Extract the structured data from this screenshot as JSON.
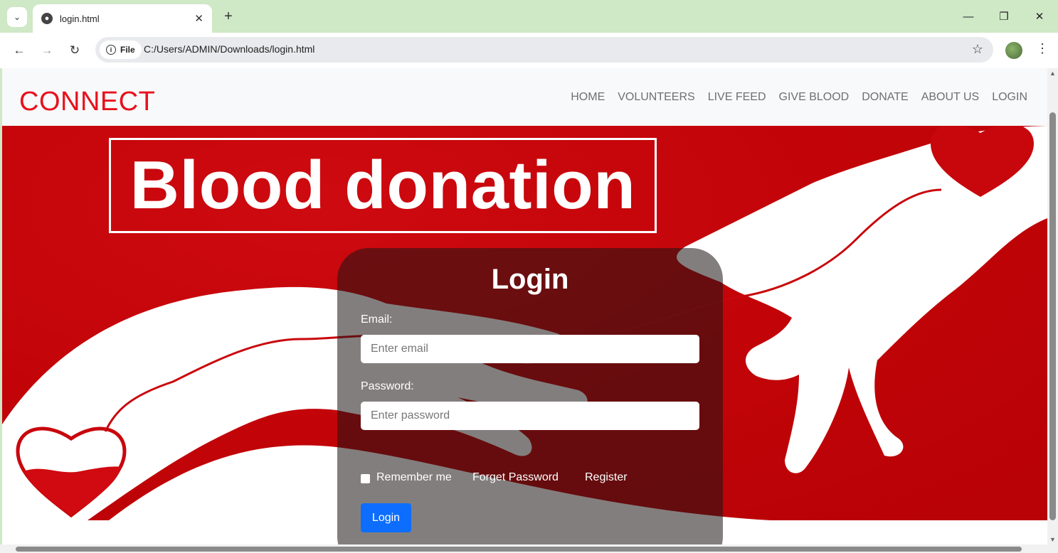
{
  "browser": {
    "tab_title": "login.html",
    "site_chip": "File",
    "url": "C:/Users/ADMIN/Downloads/login.html"
  },
  "site": {
    "brand": "CONNECT",
    "nav": [
      "HOME",
      "VOLUNTEERS",
      "LIVE FEED",
      "GIVE BLOOD",
      "DONATE",
      "ABOUT US",
      "LOGIN"
    ],
    "hero_title": "Blood donation"
  },
  "login": {
    "title": "Login",
    "email_label": "Email:",
    "email_placeholder": "Enter email",
    "password_label": "Password:",
    "password_placeholder": "Enter password",
    "remember_label": "Remember me",
    "forgot_label": "Forget Password",
    "register_label": "Register",
    "submit_label": "Login"
  },
  "colors": {
    "brand": "#e8111c",
    "hero_red": "#c8070c",
    "button_blue": "#0d6efd",
    "browser_frame": "#cfe8c6"
  }
}
